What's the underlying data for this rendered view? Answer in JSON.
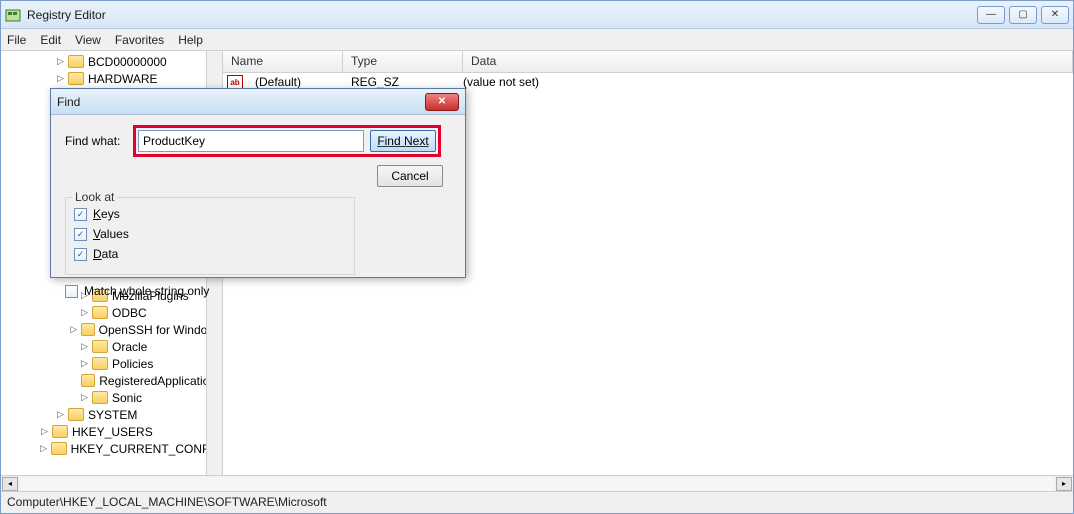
{
  "title": "Registry Editor",
  "menu": {
    "file": "File",
    "edit": "Edit",
    "view": "View",
    "favorites": "Favorites",
    "help": "Help"
  },
  "list": {
    "headers": {
      "name": "Name",
      "type": "Type",
      "data": "Data"
    },
    "row0": {
      "icon": "ab",
      "name": "(Default)",
      "type": "REG_SZ",
      "data": "(value not set)"
    }
  },
  "tree": {
    "items": [
      {
        "label": "BCD00000000",
        "indent": 48,
        "tw": "▷"
      },
      {
        "label": "HARDWARE",
        "indent": 48,
        "tw": "▷"
      },
      {
        "label": "MozillaPlugins",
        "indent": 72,
        "tw": "▷"
      },
      {
        "label": "ODBC",
        "indent": 72,
        "tw": "▷"
      },
      {
        "label": "OpenSSH for Windows",
        "indent": 72,
        "tw": "▷"
      },
      {
        "label": "Oracle",
        "indent": 72,
        "tw": "▷"
      },
      {
        "label": "Policies",
        "indent": 72,
        "tw": "▷"
      },
      {
        "label": "RegisteredApplications",
        "indent": 72,
        "tw": ""
      },
      {
        "label": "Sonic",
        "indent": 72,
        "tw": "▷"
      },
      {
        "label": "SYSTEM",
        "indent": 48,
        "tw": "▷"
      },
      {
        "label": "HKEY_USERS",
        "indent": 32,
        "tw": "▷"
      },
      {
        "label": "HKEY_CURRENT_CONFIG",
        "indent": 32,
        "tw": "▷"
      }
    ]
  },
  "find": {
    "title": "Find",
    "findwhat_label": "Find what:",
    "value": "ProductKey",
    "findnext": "Find Next",
    "cancel": "Cancel",
    "lookat_label": "Look at",
    "keys": "Keys",
    "values": "Values",
    "data": "Data",
    "match": "Match whole string only"
  },
  "statusbar": "Computer\\HKEY_LOCAL_MACHINE\\SOFTWARE\\Microsoft"
}
